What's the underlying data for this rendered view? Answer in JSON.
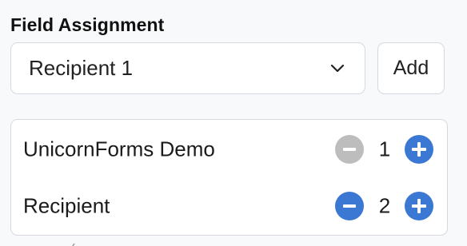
{
  "field_assignment": {
    "title": "Field Assignment",
    "selected_recipient": "Recipient 1",
    "add_label": "Add"
  },
  "fields": [
    {
      "label": "UnicornForms Demo",
      "count": "1",
      "decrement_enabled": false
    },
    {
      "label": "Recipient",
      "count": "2",
      "decrement_enabled": true
    }
  ],
  "colors": {
    "accent": "#3a78d3",
    "disabled": "#bdbdbd",
    "border": "#d6d9dd",
    "background": "#f8f9fa"
  },
  "icons": {
    "select": "chevron-down-icon",
    "decrement": "minus-icon",
    "increment": "plus-icon"
  }
}
